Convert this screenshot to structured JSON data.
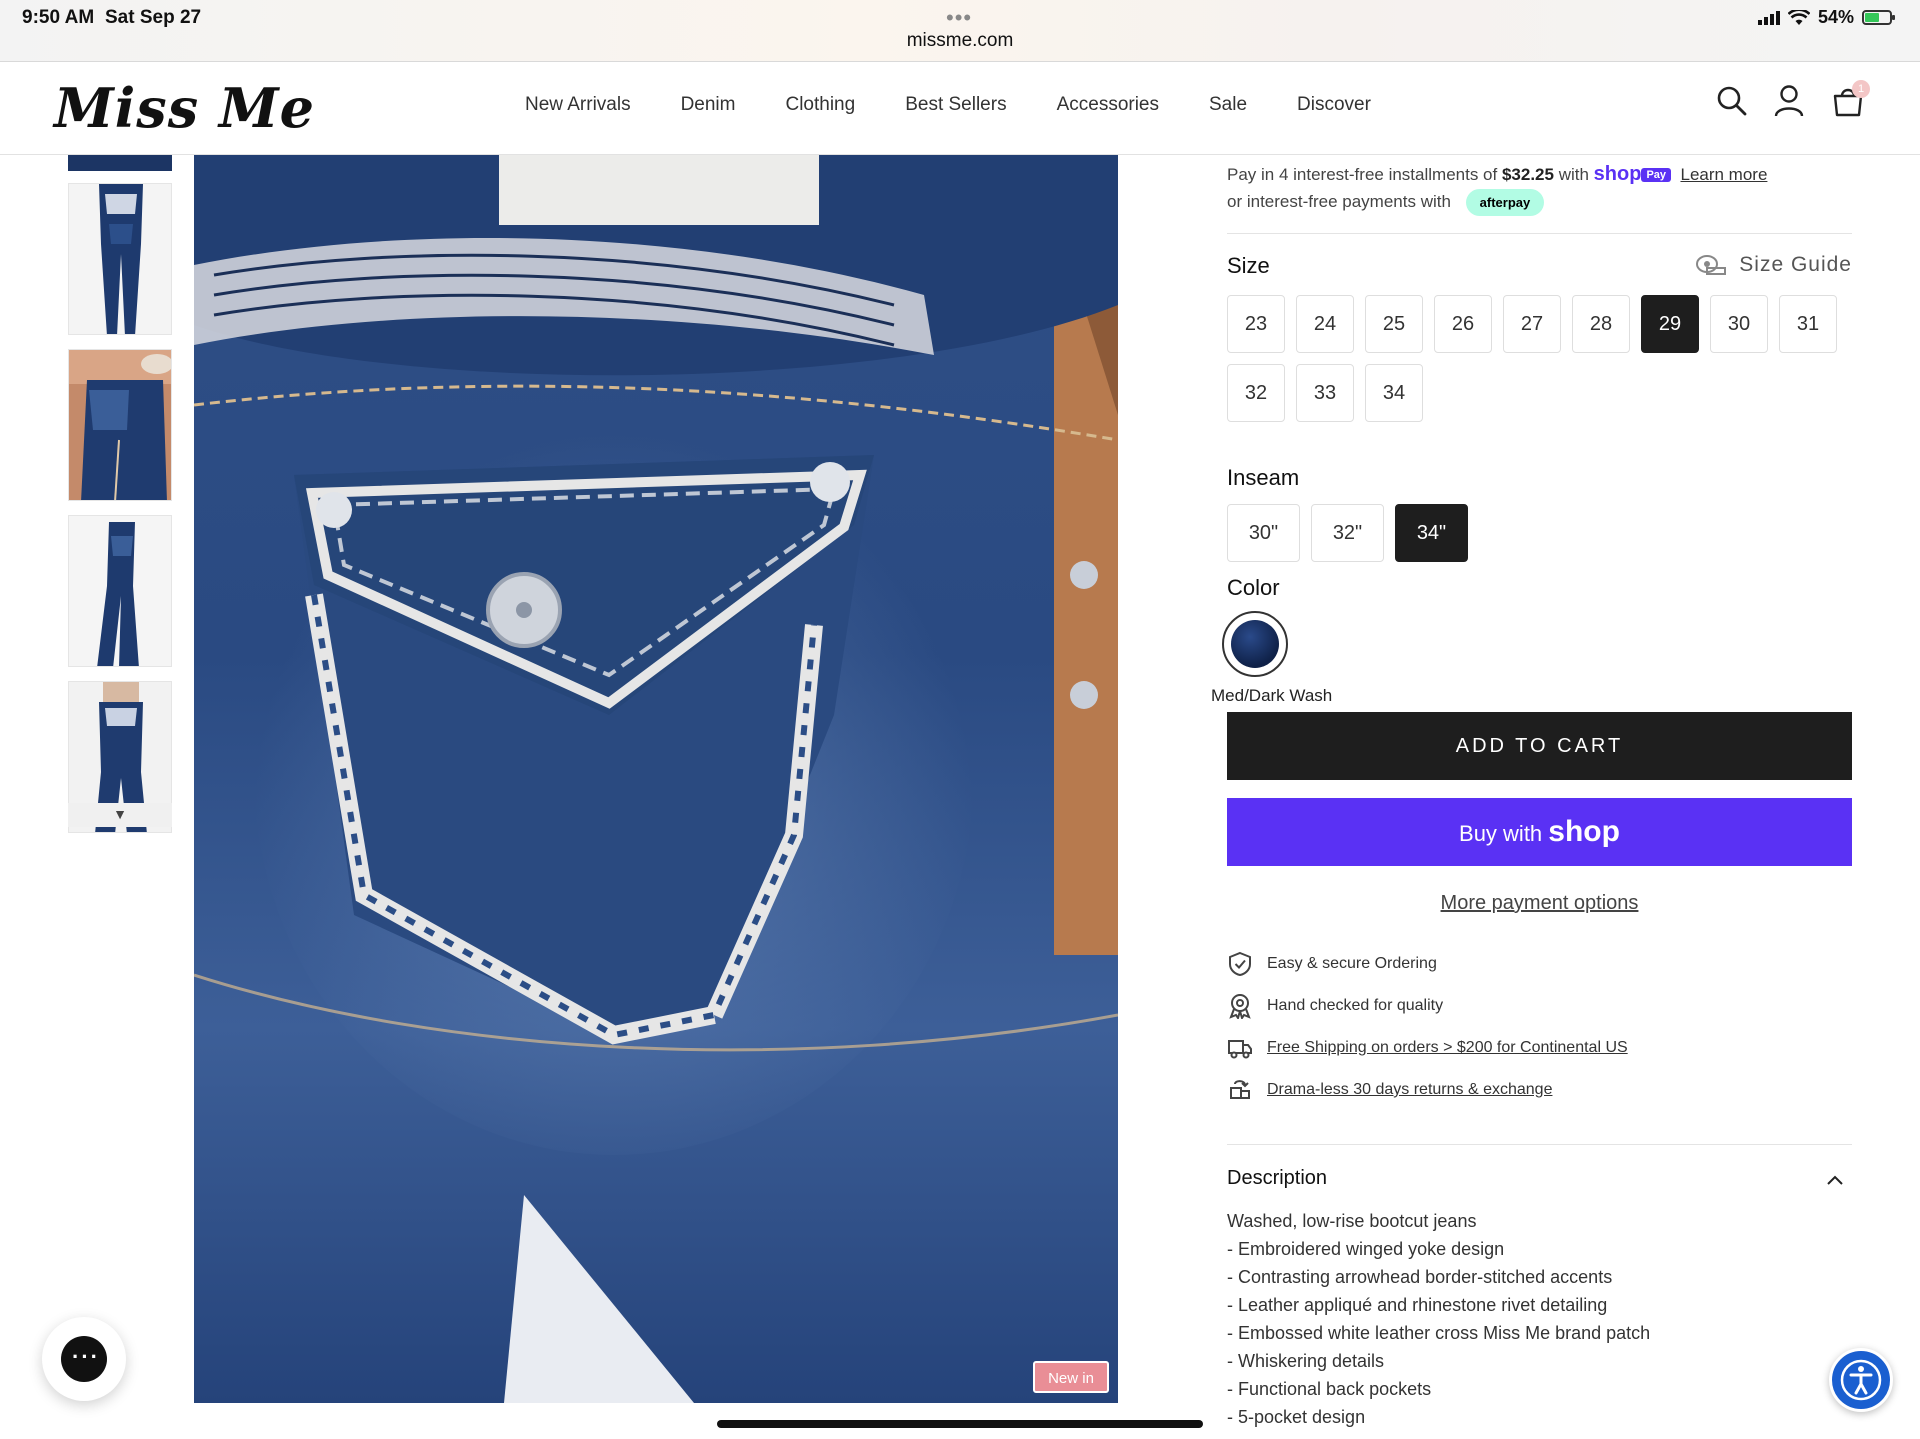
{
  "status_bar": {
    "time": "9:50 AM",
    "date": "Sat Sep 27",
    "url": "missme.com",
    "battery": "54%",
    "menu_dots": "•••"
  },
  "header": {
    "logo": "Miss Me",
    "nav": [
      "New Arrivals",
      "Denim",
      "Clothing",
      "Best Sellers",
      "Accessories",
      "Sale",
      "Discover"
    ],
    "icons": [
      "search-icon",
      "account-icon",
      "cart-icon"
    ],
    "cart_count": "1"
  },
  "gallery": {
    "new_badge": "New in",
    "scroll_arrow": "▼",
    "thumbnail_count": 5
  },
  "payment": {
    "line1_prefix": "Pay in 4 interest-free installments of",
    "installment": "$32.25",
    "line1_with": "with",
    "shop_logo": "shop",
    "shop_pill": "Pay",
    "learn_more": "Learn more",
    "line2": "or interest-free payments with",
    "afterpay": "afterpay"
  },
  "size": {
    "label": "Size",
    "guide": "Size Guide",
    "options": [
      "23",
      "24",
      "25",
      "26",
      "27",
      "28",
      "29",
      "30",
      "31",
      "32",
      "33",
      "34"
    ],
    "selected": "29"
  },
  "inseam": {
    "label": "Inseam",
    "options": [
      "30\"",
      "32\"",
      "34\""
    ],
    "selected": "34\""
  },
  "color": {
    "label": "Color",
    "name": "Med/Dark Wash",
    "swatch_hex": "#16295a"
  },
  "actions": {
    "add_to_cart": "ADD TO CART",
    "buy_with": "Buy with",
    "buy_brand": "shop",
    "more_payment": "More payment options"
  },
  "features": [
    {
      "icon": "shield-check-icon",
      "text": "Easy & secure Ordering",
      "link": false
    },
    {
      "icon": "quality-badge-icon",
      "text": "Hand checked for quality",
      "link": false
    },
    {
      "icon": "truck-icon",
      "text": "Free Shipping on orders > $200 for Continental US",
      "link": true
    },
    {
      "icon": "return-box-icon",
      "text": "Drama-less 30 days returns & exchange",
      "link": true
    }
  ],
  "description": {
    "title": "Description",
    "lines": [
      "Washed, low-rise bootcut jeans",
      "- Embroidered winged yoke design",
      "- Contrasting arrowhead border-stitched accents",
      "- Leather appliqué and rhinestone rivet detailing",
      "- Embossed white leather cross Miss Me brand patch",
      "- Whiskering details",
      "- Functional back pockets",
      "- 5-pocket design"
    ]
  },
  "colors": {
    "shop_purple": "#5a31f4",
    "button_black": "#1e1e1e",
    "afterpay_mint": "#b2fce4",
    "new_badge_pink": "#e98e96",
    "a11y_blue": "#1a5fd0"
  }
}
